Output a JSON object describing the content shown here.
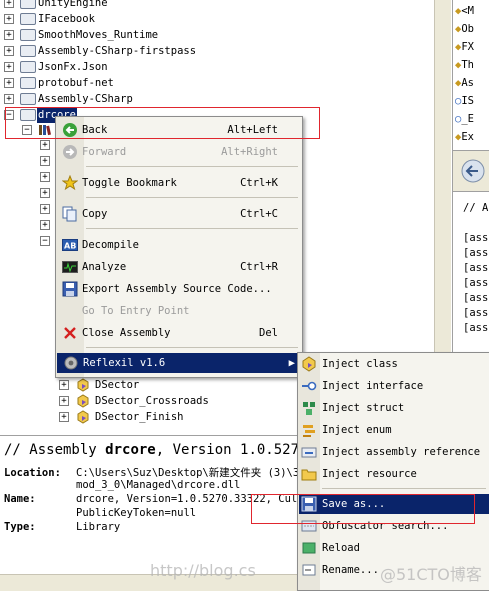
{
  "tree": {
    "items": [
      {
        "label": "UnityEngine"
      },
      {
        "label": "IFacebook"
      },
      {
        "label": "SmoothMoves_Runtime"
      },
      {
        "label": "Assembly-CSharp-firstpass"
      },
      {
        "label": "JsonFx.Json"
      },
      {
        "label": "protobuf-net"
      },
      {
        "label": "Assembly-CSharp"
      },
      {
        "label": "drcore"
      }
    ],
    "children": [
      {
        "label": "DSector"
      },
      {
        "label": "DSector_Crossroads"
      },
      {
        "label": "DSector_Finish"
      }
    ]
  },
  "context_menu": {
    "items": [
      {
        "label": "Back",
        "shortcut": "Alt+Left",
        "icon": "back-arrow-icon"
      },
      {
        "label": "Forward",
        "shortcut": "Alt+Right",
        "icon": "forward-arrow-icon"
      },
      {
        "label": "Toggle Bookmark",
        "shortcut": "Ctrl+K",
        "icon": "bookmark-star-icon"
      },
      {
        "label": "Copy",
        "shortcut": "Ctrl+C",
        "icon": "copy-icon"
      },
      {
        "label": "Decompile",
        "shortcut": "",
        "icon": "decompile-icon"
      },
      {
        "label": "Analyze",
        "shortcut": "Ctrl+R",
        "icon": "analyze-icon"
      },
      {
        "label": "Export Assembly Source Code...",
        "shortcut": "",
        "icon": "save-disk-icon"
      },
      {
        "label": "Go To Entry Point",
        "shortcut": "",
        "icon": ""
      },
      {
        "label": "Close Assembly",
        "shortcut": "Del",
        "icon": "close-x-icon"
      },
      {
        "label": "Reflexil v1.6",
        "shortcut": "",
        "icon": "reflexil-gear-icon"
      }
    ]
  },
  "submenu": {
    "items": [
      {
        "label": "Inject class"
      },
      {
        "label": "Inject interface"
      },
      {
        "label": "Inject struct"
      },
      {
        "label": "Inject enum"
      },
      {
        "label": "Inject assembly reference"
      },
      {
        "label": "Inject resource"
      },
      {
        "label": "Save as..."
      },
      {
        "label": "Obfuscator search..."
      },
      {
        "label": "Reload"
      },
      {
        "label": "Rename..."
      }
    ]
  },
  "right_panel": {
    "items": [
      "<M",
      "Ob",
      "FX",
      "Th",
      "As",
      "IS",
      "_E",
      "Ex"
    ],
    "code_lines": [
      "// A",
      "[ass",
      "[ass",
      "[ass",
      "[ass",
      "[ass",
      "[ass",
      "[ass"
    ]
  },
  "bottom": {
    "header_prefix": "// Assembly ",
    "header_name": "drcore",
    "header_suffix": ", Version 1.0.5270",
    "location_label": "Location:",
    "location_value_1": "C:\\Users\\Suz\\Desktop\\新建文件夹 (3)\\3",
    "location_value_2": "mod_3_0\\Managed\\drcore.dll",
    "name_label": "Name:",
    "name_value_1": "drcore, Version=1.0.5270.33322, Cultu",
    "name_value_2": "PublicKeyToken=null",
    "type_label": "Type:",
    "type_value": "Library"
  },
  "watermark": {
    "left": "http://blog.cs",
    "right": "@51CTO博客"
  },
  "colors": {
    "highlight": "#0a246a",
    "annotation_red": "#e0262e"
  }
}
